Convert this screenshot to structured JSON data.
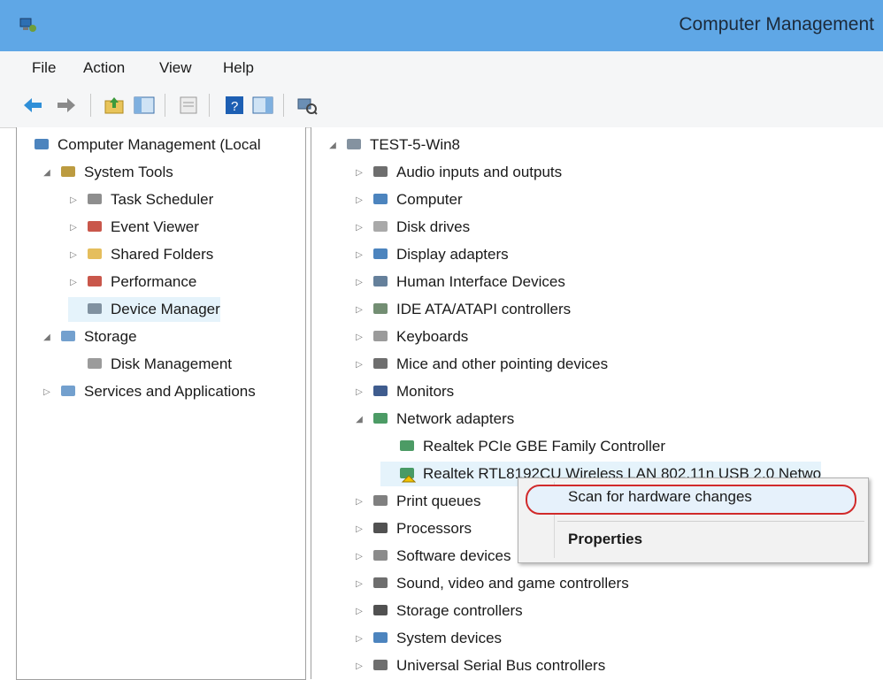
{
  "window": {
    "title": "Computer Management"
  },
  "menu": [
    "File",
    "Action",
    "View",
    "Help"
  ],
  "toolbar": {
    "buttons": [
      "back-icon",
      "forward-icon",
      "up-folder-icon",
      "show-hide-console-tree-icon",
      "properties-icon",
      "help-icon",
      "show-action-pane-icon",
      "scan-hardware-icon"
    ]
  },
  "left_tree": [
    {
      "label": "Computer Management (Local",
      "icon": "computer-management-icon",
      "indent": 0,
      "expander": ""
    },
    {
      "label": "System Tools",
      "icon": "system-tools-icon",
      "indent": 1,
      "expander": "◢"
    },
    {
      "label": "Task Scheduler",
      "icon": "clock-icon",
      "indent": 2,
      "expander": "▷"
    },
    {
      "label": "Event Viewer",
      "icon": "event-viewer-icon",
      "indent": 2,
      "expander": "▷"
    },
    {
      "label": "Shared Folders",
      "icon": "shared-folder-icon",
      "indent": 2,
      "expander": "▷"
    },
    {
      "label": "Performance",
      "icon": "performance-icon",
      "indent": 2,
      "expander": "▷"
    },
    {
      "label": "Device Manager",
      "icon": "device-manager-icon",
      "indent": 2,
      "expander": "",
      "selected": true
    },
    {
      "label": "Storage",
      "icon": "storage-icon",
      "indent": 1,
      "expander": "◢"
    },
    {
      "label": "Disk Management",
      "icon": "disk-management-icon",
      "indent": 2,
      "expander": ""
    },
    {
      "label": "Services and Applications",
      "icon": "services-icon",
      "indent": 1,
      "expander": "▷"
    }
  ],
  "right_tree": [
    {
      "label": "TEST-5-Win8",
      "icon": "computer-root-icon",
      "indent": 0,
      "expander": "◢"
    },
    {
      "label": "Audio inputs and outputs",
      "icon": "speaker-icon",
      "indent": 1,
      "expander": "▷"
    },
    {
      "label": "Computer",
      "icon": "computer-icon",
      "indent": 1,
      "expander": "▷"
    },
    {
      "label": "Disk drives",
      "icon": "disk-drive-icon",
      "indent": 1,
      "expander": "▷"
    },
    {
      "label": "Display adapters",
      "icon": "display-adapter-icon",
      "indent": 1,
      "expander": "▷"
    },
    {
      "label": "Human Interface Devices",
      "icon": "hid-icon",
      "indent": 1,
      "expander": "▷"
    },
    {
      "label": "IDE ATA/ATAPI controllers",
      "icon": "ide-controller-icon",
      "indent": 1,
      "expander": "▷"
    },
    {
      "label": "Keyboards",
      "icon": "keyboard-icon",
      "indent": 1,
      "expander": "▷"
    },
    {
      "label": "Mice and other pointing devices",
      "icon": "mouse-icon",
      "indent": 1,
      "expander": "▷"
    },
    {
      "label": "Monitors",
      "icon": "monitor-icon",
      "indent": 1,
      "expander": "▷"
    },
    {
      "label": "Network adapters",
      "icon": "network-adapter-icon",
      "indent": 1,
      "expander": "◢"
    },
    {
      "label": "Realtek PCIe GBE Family Controller",
      "icon": "network-card-icon",
      "indent": 2,
      "expander": ""
    },
    {
      "label": "Realtek RTL8192CU Wireless LAN 802.11n USB 2.0 Netwo",
      "icon": "network-card-warning-icon",
      "indent": 2,
      "expander": "",
      "selected": true
    },
    {
      "label": "Print queues",
      "icon": "printer-icon",
      "indent": 1,
      "expander": "▷"
    },
    {
      "label": "Processors",
      "icon": "processor-icon",
      "indent": 1,
      "expander": "▷"
    },
    {
      "label": "Software devices",
      "icon": "software-device-icon",
      "indent": 1,
      "expander": "▷"
    },
    {
      "label": "Sound, video and game controllers",
      "icon": "sound-icon",
      "indent": 1,
      "expander": "▷"
    },
    {
      "label": "Storage controllers",
      "icon": "storage-controller-icon",
      "indent": 1,
      "expander": "▷"
    },
    {
      "label": "System devices",
      "icon": "system-device-icon",
      "indent": 1,
      "expander": "▷"
    },
    {
      "label": "Universal Serial Bus controllers",
      "icon": "usb-icon",
      "indent": 1,
      "expander": "▷"
    }
  ],
  "context_menu": {
    "items": [
      "Scan for hardware changes",
      "Properties"
    ]
  },
  "colors": {
    "titlebar": "#5fa7e6",
    "selection": "#e5f3fb",
    "highlight_ring": "#d12a2a"
  }
}
